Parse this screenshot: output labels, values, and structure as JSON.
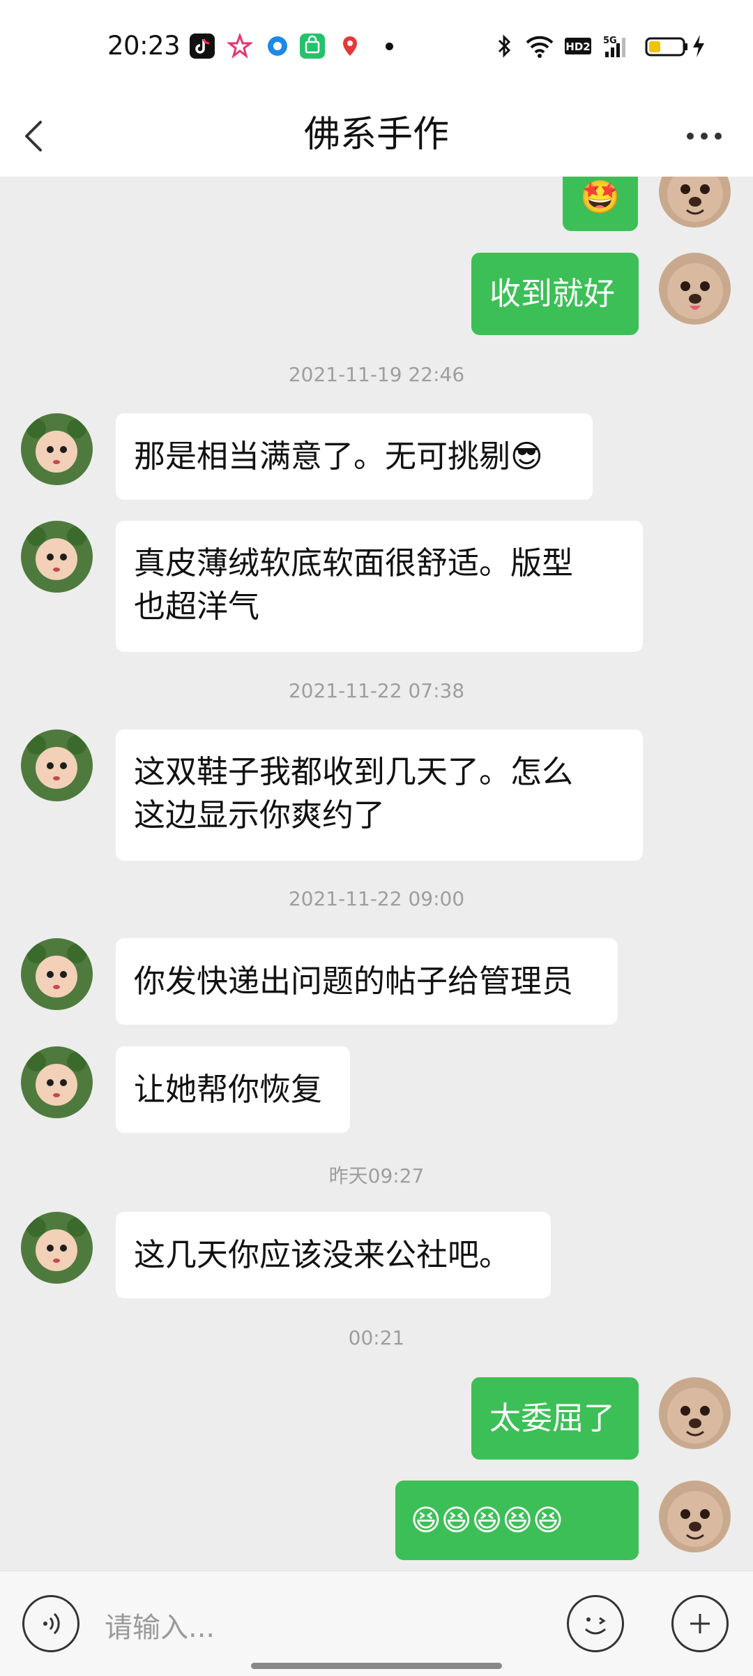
{
  "status_bar": {
    "time": "20:23",
    "app_icons": [
      "tiktok-icon",
      "star-app-icon",
      "circle-app-icon",
      "green-bag-app-icon",
      "pin-app-icon"
    ],
    "right_icons": [
      "bluetooth-icon",
      "wifi-icon",
      "hd-icon",
      "signal-5g-icon",
      "battery-icon",
      "charging-icon"
    ],
    "hd_label": "HD2",
    "network_label": "5G"
  },
  "header": {
    "title": "佛系手作"
  },
  "messages": [
    {
      "side": "out",
      "text": "🤩"
    },
    {
      "side": "out",
      "text": "收到就好"
    },
    {
      "timestamp": "2021-11-19 22:46"
    },
    {
      "side": "in",
      "text": "那是相当满意了。无可挑剔😎"
    },
    {
      "side": "in",
      "text": "真皮薄绒软底软面很舒适。版型也超洋气"
    },
    {
      "timestamp": "2021-11-22 07:38"
    },
    {
      "side": "in",
      "text": "这双鞋子我都收到几天了。怎么这边显示你爽约了"
    },
    {
      "timestamp": "2021-11-22 09:00"
    },
    {
      "side": "in",
      "text": "你发快递出问题的帖子给管理员"
    },
    {
      "side": "in",
      "text": "让她帮你恢复"
    },
    {
      "timestamp": "昨天09:27"
    },
    {
      "side": "in",
      "text": "这几天你应该没来公社吧。"
    },
    {
      "timestamp": "00:21"
    },
    {
      "side": "out",
      "text": "太委屈了"
    },
    {
      "side": "out",
      "text": "😆😆😆😆😆"
    }
  ],
  "bubble_text": {
    "m0": "🤩",
    "m1": "收到就好",
    "m3": "那是相当满意了。无可挑剔😎",
    "m4a": "真皮薄绒软底软面很舒适。版型",
    "m4b": "也超洋气",
    "m6a": "这双鞋子我都收到几天了。怎么",
    "m6b": "这边显示你爽约了",
    "m8": "你发快递出问题的帖子给管理员",
    "m9": "让她帮你恢复",
    "m11": "这几天你应该没来公社吧。",
    "m13": "太委屈了",
    "m14": "😆😆😆😆😆"
  },
  "timestamps": {
    "t2": "2021-11-19 22:46",
    "t5": "2021-11-22 07:38",
    "t7": "2021-11-22 09:00",
    "t10": "昨天09:27",
    "t12": "00:21"
  },
  "input_bar": {
    "placeholder": "请输入..."
  },
  "colors": {
    "out_bubble": "#3dbf57",
    "in_bubble": "#ffffff",
    "chat_background": "#ededed"
  }
}
